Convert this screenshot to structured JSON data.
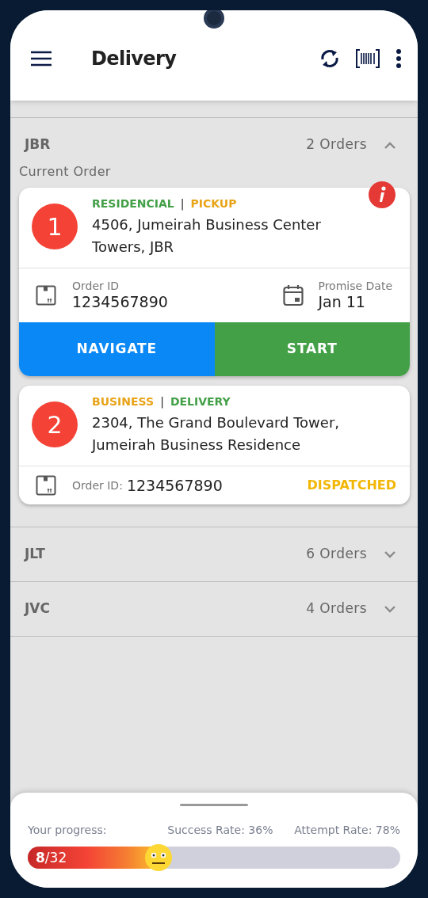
{
  "app_bar": {
    "title": "Delivery"
  },
  "groups": [
    {
      "name": "JBR",
      "count": "2 Orders",
      "expanded": true,
      "section_label": "Current Order",
      "orders": [
        {
          "kind": "detailed",
          "number": "1",
          "tags": [
            {
              "text": "RESIDENCIAL",
              "color": "#43a047"
            },
            {
              "text": "PICKUP",
              "color": "#e8a317"
            }
          ],
          "separator": "|",
          "address": "4506, Jumeirah Business Center Towers, JBR",
          "info": true,
          "order_id_label": "Order ID",
          "order_id": "1234567890",
          "date_label": "Promise Date",
          "date": "Jan 11",
          "buttons": [
            {
              "label": "NAVIGATE",
              "kind": "navigate"
            },
            {
              "label": "START",
              "kind": "start"
            }
          ]
        },
        {
          "kind": "compact",
          "number": "2",
          "tags": [
            {
              "text": "BUSINESS",
              "color": "#e8a317"
            },
            {
              "text": "DELIVERY",
              "color": "#43a047"
            }
          ],
          "separator": "|",
          "address": "2304, The Grand Boulevard Tower, Jumeirah Business Residence",
          "info": false,
          "order_id_label": "Order ID:",
          "order_id": "1234567890",
          "status": "DISPATCHED"
        }
      ]
    },
    {
      "name": "JLT",
      "count": "6 Orders",
      "expanded": false
    },
    {
      "name": "JVC",
      "count": "4 Orders",
      "expanded": false
    }
  ],
  "progress": {
    "label": "Your progress:",
    "success": "Success Rate: 36%",
    "attempt": "Attempt Rate: 78%",
    "count": "**8**/32",
    "level": 0.35
  }
}
